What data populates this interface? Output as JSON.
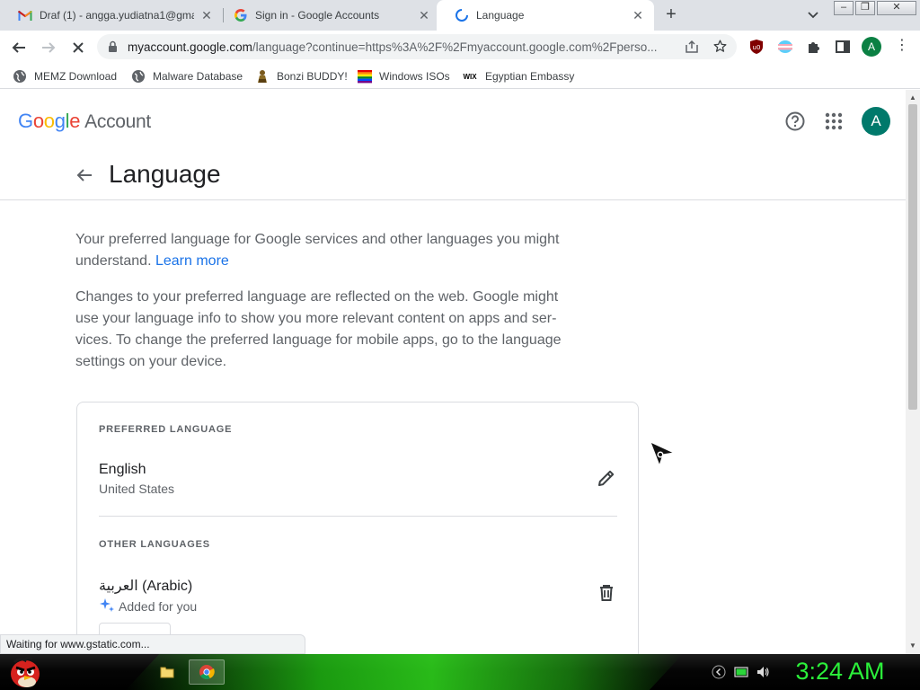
{
  "browser": {
    "tabs": [
      {
        "title": "Draf (1) - angga.yudiatna1@gma",
        "favicon": "gmail-icon",
        "active": false
      },
      {
        "title": "Sign in - Google Accounts",
        "favicon": "google-g-icon",
        "active": false
      },
      {
        "title": "Language",
        "favicon": "loading-spinner-icon",
        "active": true
      }
    ],
    "tab_close_glyph": "✕",
    "new_tab_glyph": "+",
    "window_buttons": {
      "minimize": "–",
      "restore": "❐",
      "close": "✕"
    },
    "url_host": "myaccount.google.com",
    "url_rest": "/language?continue=https%3A%2F%2Fmyaccount.google.com%2Fperso...",
    "profile_initial": "A",
    "menu_glyph": "⋮",
    "bookmarks": [
      {
        "label": "MEMZ Download",
        "icon": "globe-icon"
      },
      {
        "label": "Malware Database",
        "icon": "globe-icon"
      },
      {
        "label": "Bonzi BUDDY!",
        "icon": "bonzi-icon"
      },
      {
        "label": "Windows ISOs",
        "icon": "windows-flag-icon"
      },
      {
        "label": "Egyptian Embassy",
        "icon": "wix-icon"
      }
    ],
    "bookmark_wix_text": "WIX",
    "status_text": "Waiting for www.gstatic.com...",
    "scroll_up_glyph": "▲",
    "scroll_down_glyph": "▼"
  },
  "page": {
    "logo": {
      "letters": [
        "G",
        "o",
        "o",
        "g",
        "l",
        "e"
      ],
      "account": "Account"
    },
    "colors": {
      "blue": "#4285F4",
      "red": "#EA4335",
      "yellow": "#FBBC05",
      "green": "#34A853",
      "link": "#1a73e8",
      "avatar": "#00796b"
    },
    "avatar_initial": "A",
    "title": "Language",
    "intro_text": "Your preferred language for Google services and other languages you might understand.",
    "learn_more": "Learn more",
    "changes_text": "Changes to your preferred language are reflected on the web. Google might use your language info to show you more relevant content on apps and ser­vices. To change the preferred language for mobile apps, go to the language settings on your device.",
    "preferred_section": "PREFERRED LANGUAGE",
    "preferred_language": {
      "name": "English",
      "region": "United States"
    },
    "other_section": "OTHER LANGUAGES",
    "other_languages": [
      {
        "name": "العربية (Arabic)",
        "note": "Added for you"
      }
    ]
  },
  "taskbar": {
    "clock": "3:24 AM",
    "items": [
      "file-explorer-icon",
      "chrome-icon"
    ],
    "tray": [
      "chevron-left-icon",
      "battery-icon",
      "volume-icon"
    ]
  }
}
